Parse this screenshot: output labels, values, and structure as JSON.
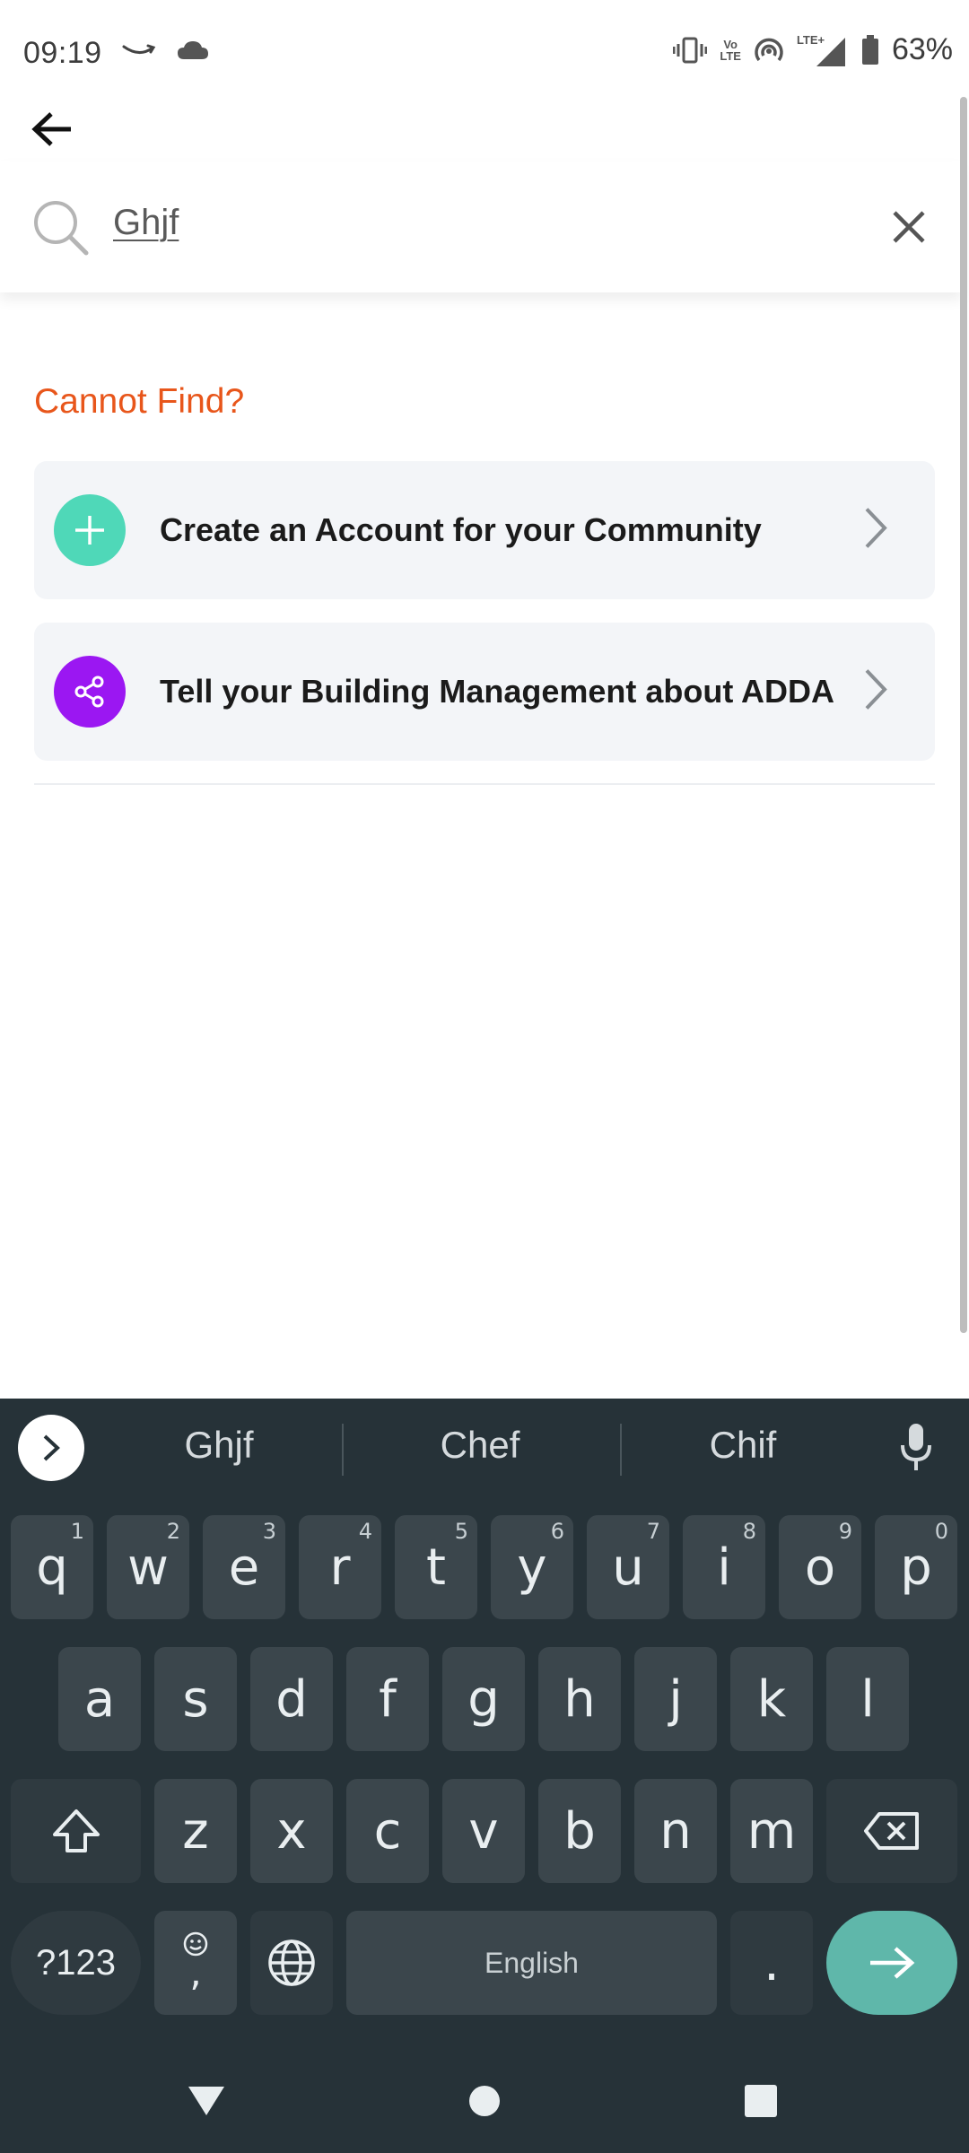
{
  "status_bar": {
    "time": "09:19",
    "battery_percent": "63%",
    "network": "LTE+",
    "volte_top": "Vo",
    "volte_bottom": "LTE"
  },
  "app_bar": {
    "back_icon": "arrow-left-icon"
  },
  "search": {
    "value": "Ghjf",
    "clear_icon": "close-icon",
    "search_icon": "search-icon"
  },
  "content": {
    "cannot_find": "Cannot Find?",
    "options": [
      {
        "label": "Create an Account for your Community",
        "icon": "plus-icon",
        "color": "#4fd8b8"
      },
      {
        "label": "Tell your Building Management about ADDA",
        "icon": "share-icon",
        "color": "#9b17f2"
      }
    ],
    "accent_color": "#e8561b"
  },
  "keyboard": {
    "suggestions": [
      "Ghjf",
      "Chef",
      "Chif"
    ],
    "row1": [
      {
        "key": "q",
        "hint": "1"
      },
      {
        "key": "w",
        "hint": "2"
      },
      {
        "key": "e",
        "hint": "3"
      },
      {
        "key": "r",
        "hint": "4"
      },
      {
        "key": "t",
        "hint": "5"
      },
      {
        "key": "y",
        "hint": "6"
      },
      {
        "key": "u",
        "hint": "7"
      },
      {
        "key": "i",
        "hint": "8"
      },
      {
        "key": "o",
        "hint": "9"
      },
      {
        "key": "p",
        "hint": "0"
      }
    ],
    "row2": [
      "a",
      "s",
      "d",
      "f",
      "g",
      "h",
      "j",
      "k",
      "l"
    ],
    "row3": [
      "z",
      "x",
      "c",
      "v",
      "b",
      "n",
      "m"
    ],
    "symbols_label": "?123",
    "comma_label": ",",
    "space_label": "English",
    "period_label": ".",
    "theme_color": "#263238",
    "enter_color": "#5fb7aa"
  },
  "nav_bar": {
    "back": "triangle-back-icon",
    "home": "circle-home-icon",
    "recents": "square-recents-icon"
  }
}
